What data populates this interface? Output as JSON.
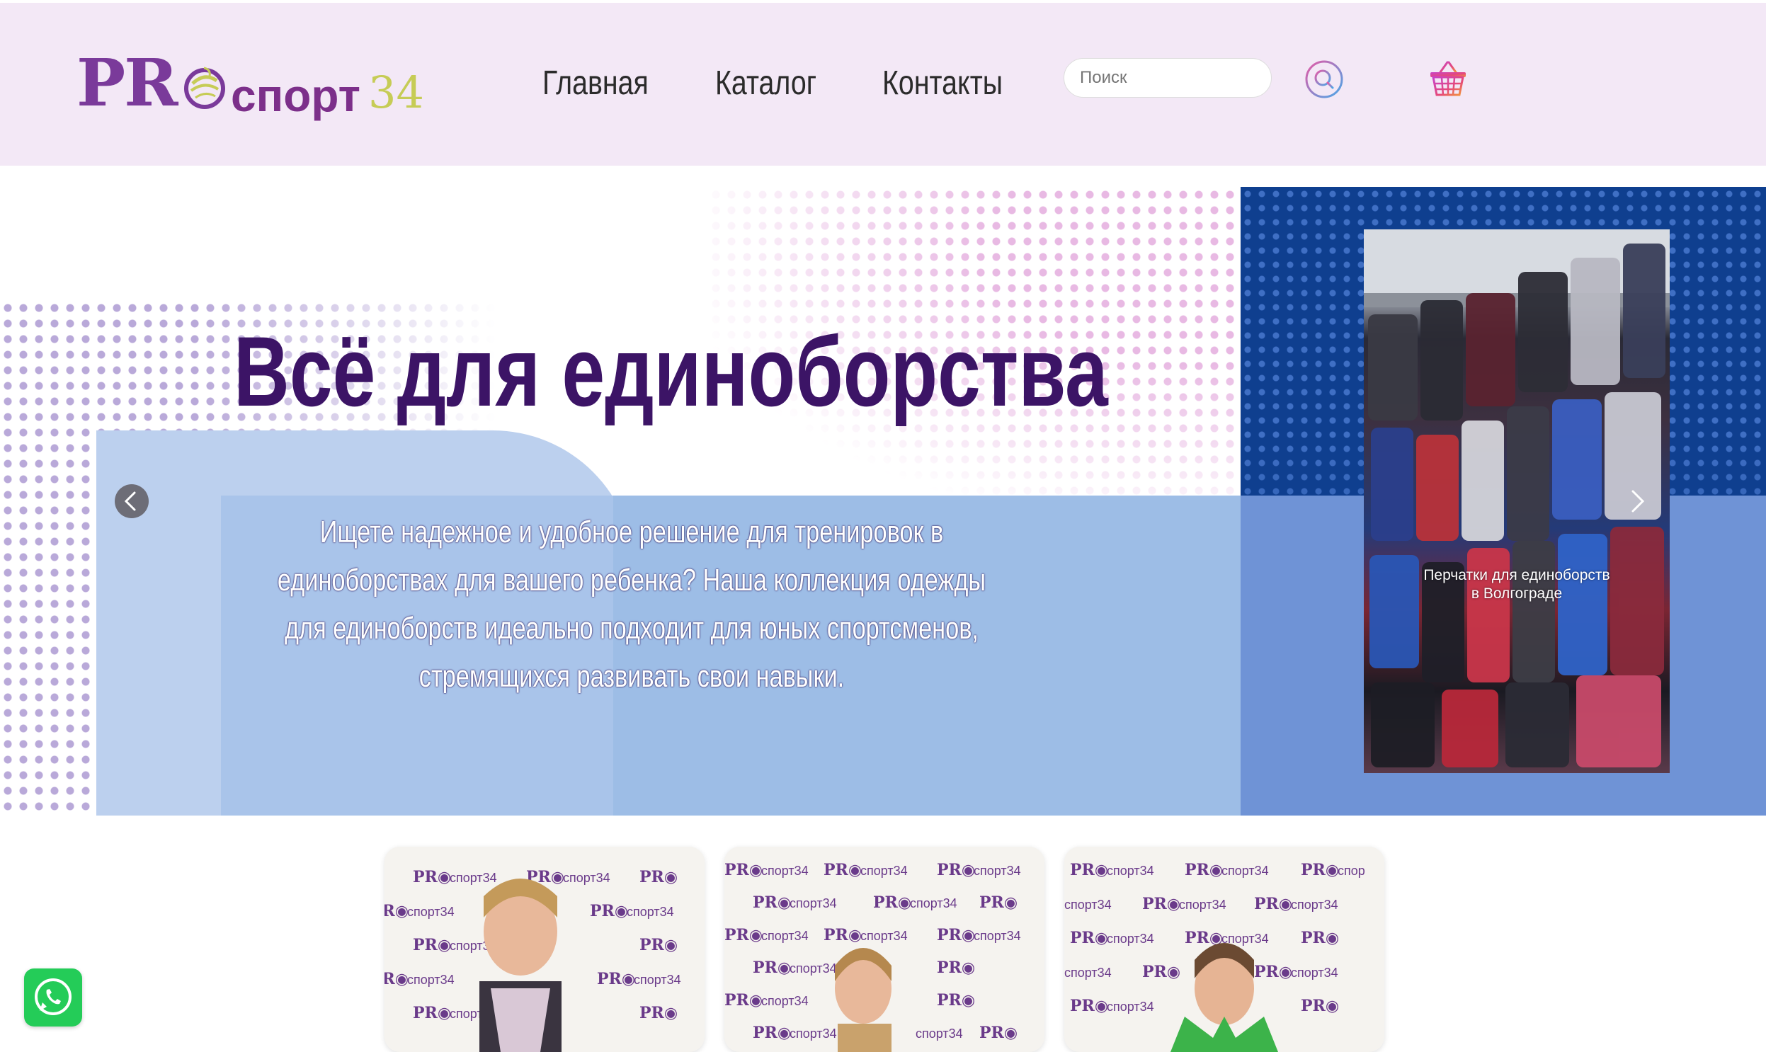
{
  "header": {
    "logo": {
      "pro": "PR",
      "sport": "спорт",
      "num": "34"
    },
    "nav": [
      {
        "label": "Главная"
      },
      {
        "label": "Каталог"
      },
      {
        "label": "Контакты"
      }
    ],
    "search_placeholder": "Поиск",
    "icons": {
      "search": "search-icon",
      "cart": "basket-icon"
    }
  },
  "hero": {
    "title": "Всё для единоборства",
    "text": "Ищете надежное и удобное решение для тренировок в единоборствах для вашего ребенка? Наша коллекция одежды для единоборств идеально подходит для юных спортсменов, стремящихся развивать свои навыки.",
    "photo_caption_line1": "Перчатки для единоборств",
    "photo_caption_line2": "в Волгограде",
    "icons": {
      "prev": "chevron-left-icon",
      "next": "chevron-right-icon"
    }
  },
  "cards": [
    {
      "logo_text": "PRO спорт34"
    },
    {
      "logo_text": "PRO спорт34"
    },
    {
      "logo_text": "PRO спорт34"
    }
  ],
  "colors": {
    "header_bg": "#f3e8f6",
    "title": "#3c1466",
    "dark_panel": "#0f3f8f",
    "light_blue": "#a9c4ea",
    "whatsapp": "#24cc58"
  }
}
